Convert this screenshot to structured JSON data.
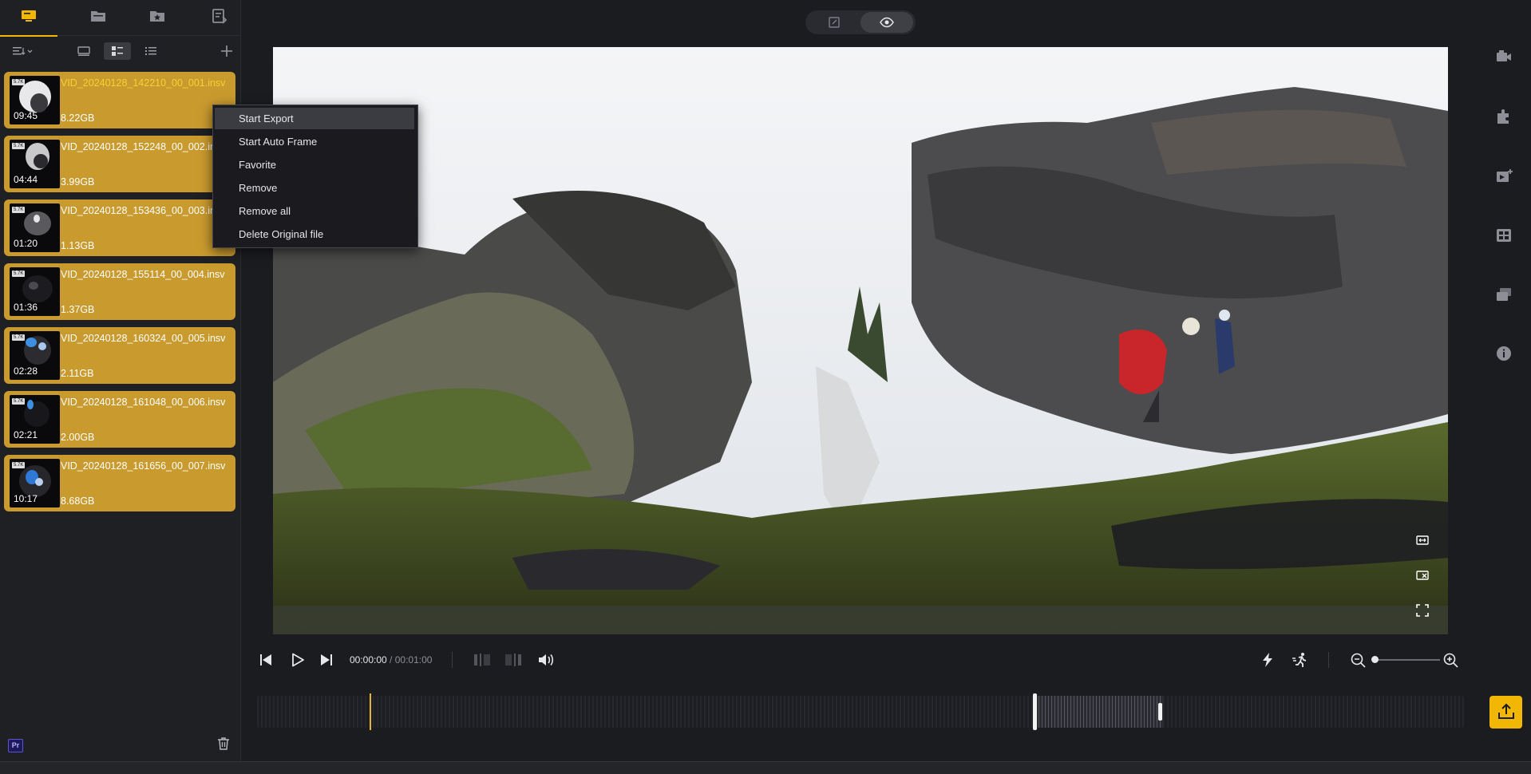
{
  "sidebar": {
    "files": [
      {
        "name": "VID_20240128_142210_00_001.insv",
        "duration": "09:45",
        "size": "8.22GB",
        "badge": "5.7K"
      },
      {
        "name": "VID_20240128_152248_00_002.insv",
        "duration": "04:44",
        "size": "3.99GB",
        "badge": "5.7K"
      },
      {
        "name": "VID_20240128_153436_00_003.insv",
        "duration": "01:20",
        "size": "1.13GB",
        "badge": "5.7K"
      },
      {
        "name": "VID_20240128_155114_00_004.insv",
        "duration": "01:36",
        "size": "1.37GB",
        "badge": "5.7K"
      },
      {
        "name": "VID_20240128_160324_00_005.insv",
        "duration": "02:28",
        "size": "2.11GB",
        "badge": "5.7K"
      },
      {
        "name": "VID_20240128_161048_00_006.insv",
        "duration": "02:21",
        "size": "2.00GB",
        "badge": "5.7K"
      },
      {
        "name": "VID_20240128_161656_00_007.insv",
        "duration": "10:17",
        "size": "8.68GB",
        "badge": "5.7K"
      }
    ],
    "pr_badge": "Pr"
  },
  "context_menu": {
    "items": [
      "Start Export",
      "Start Auto Frame",
      "Favorite",
      "Remove",
      "Remove all",
      "Delete Original file"
    ]
  },
  "player": {
    "current_time": "00:00:00",
    "separator": " / ",
    "total_time": "00:01:00"
  },
  "colors": {
    "accent": "#f2b705",
    "card": "#c99a2e",
    "background": "#1b1c20"
  },
  "icons": {
    "nav": [
      "monitor-icon",
      "folder-icon",
      "favorite-folder-icon",
      "task-list-icon"
    ],
    "rail": [
      "camera-icon",
      "plugin-icon",
      "media-add-icon",
      "template-icon",
      "stack-icon",
      "info-icon"
    ]
  }
}
